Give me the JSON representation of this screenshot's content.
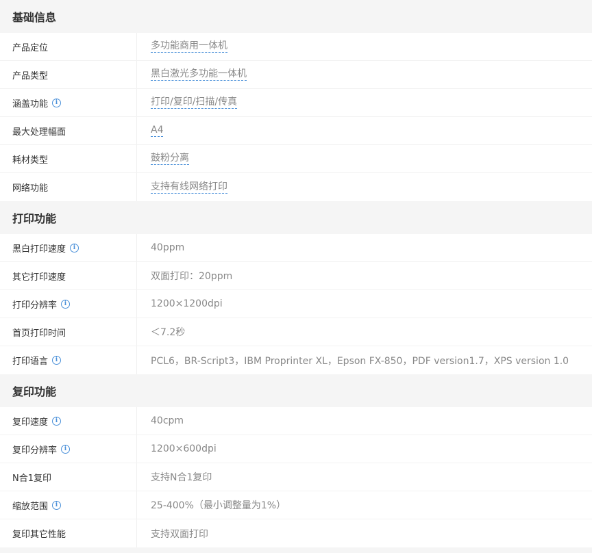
{
  "sections": [
    {
      "title": "基础信息",
      "rows": [
        {
          "label": "产品定位",
          "value": "多功能商用一体机"
        },
        {
          "label": "产品类型",
          "value": "黑白激光多功能一体机"
        },
        {
          "label": "涵盖功能",
          "value": "打印/复印/扫描/传真"
        },
        {
          "label": "最大处理幅面",
          "value": "A4"
        },
        {
          "label": "耗材类型",
          "value": "鼓粉分离"
        },
        {
          "label": "网络功能",
          "value": "支持有线网络打印"
        }
      ]
    },
    {
      "title": "打印功能",
      "rows": [
        {
          "label": "黑白打印速度",
          "value": "40ppm"
        },
        {
          "label": "其它打印速度",
          "value": "双面打印：20ppm"
        },
        {
          "label": "打印分辨率",
          "value": "1200×1200dpi"
        },
        {
          "label": "首页打印时间",
          "value": "＜7.2秒"
        },
        {
          "label": "打印语言",
          "value": "PCL6，BR-Script3，IBM Proprinter XL，Epson FX-850，PDF version1.7，XPS version 1.0"
        }
      ]
    },
    {
      "title": "复印功能",
      "rows": [
        {
          "label": "复印速度",
          "value": "40cpm"
        },
        {
          "label": "复印分辨率",
          "value": "1200×600dpi"
        },
        {
          "label": "N合1复印",
          "value": "支持N合1复印"
        },
        {
          "label": "缩放范围",
          "value": "25-400%（最小调整量为1%）"
        },
        {
          "label": "复印其它性能",
          "value": "支持双面打印"
        }
      ]
    }
  ],
  "icons": {
    "info": "i",
    "accent_color": "#4a90d9"
  }
}
